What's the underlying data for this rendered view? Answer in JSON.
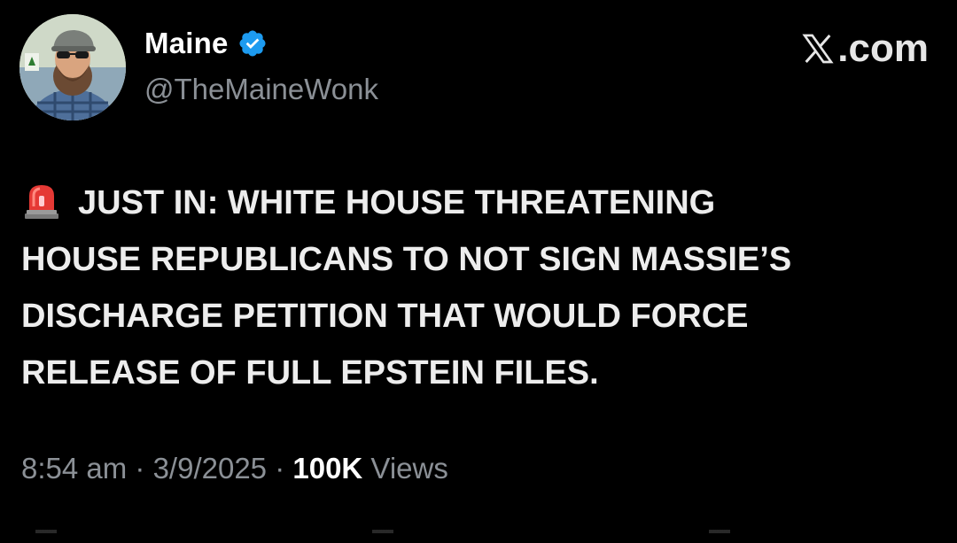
{
  "author": {
    "display_name": "Maine",
    "handle": "@TheMaineWonk",
    "verified": true,
    "avatar_icon": "avatar-photo"
  },
  "brand": {
    "label": "X.com",
    "logo_text": "𝕏",
    "logo_icon": "x-logo-icon"
  },
  "tweet": {
    "emoji_icon": "siren-icon",
    "lines": [
      "JUST IN: WHITE HOUSE THREATENING",
      "HOUSE REPUBLICANS TO NOT SIGN MASSIE’S",
      "DISCHARGE PETITION THAT WOULD FORCE",
      "RELEASE OF FULL EPSTEIN FILES."
    ]
  },
  "meta": {
    "time": "8:54 am",
    "separator": " · ",
    "date": "3/9/2025",
    "views_count": "100K",
    "views_label": " Views"
  },
  "colors": {
    "background": "#000000",
    "text": "#ededed",
    "secondary": "#8b9096",
    "verified_blue": "#1d9bf0"
  }
}
